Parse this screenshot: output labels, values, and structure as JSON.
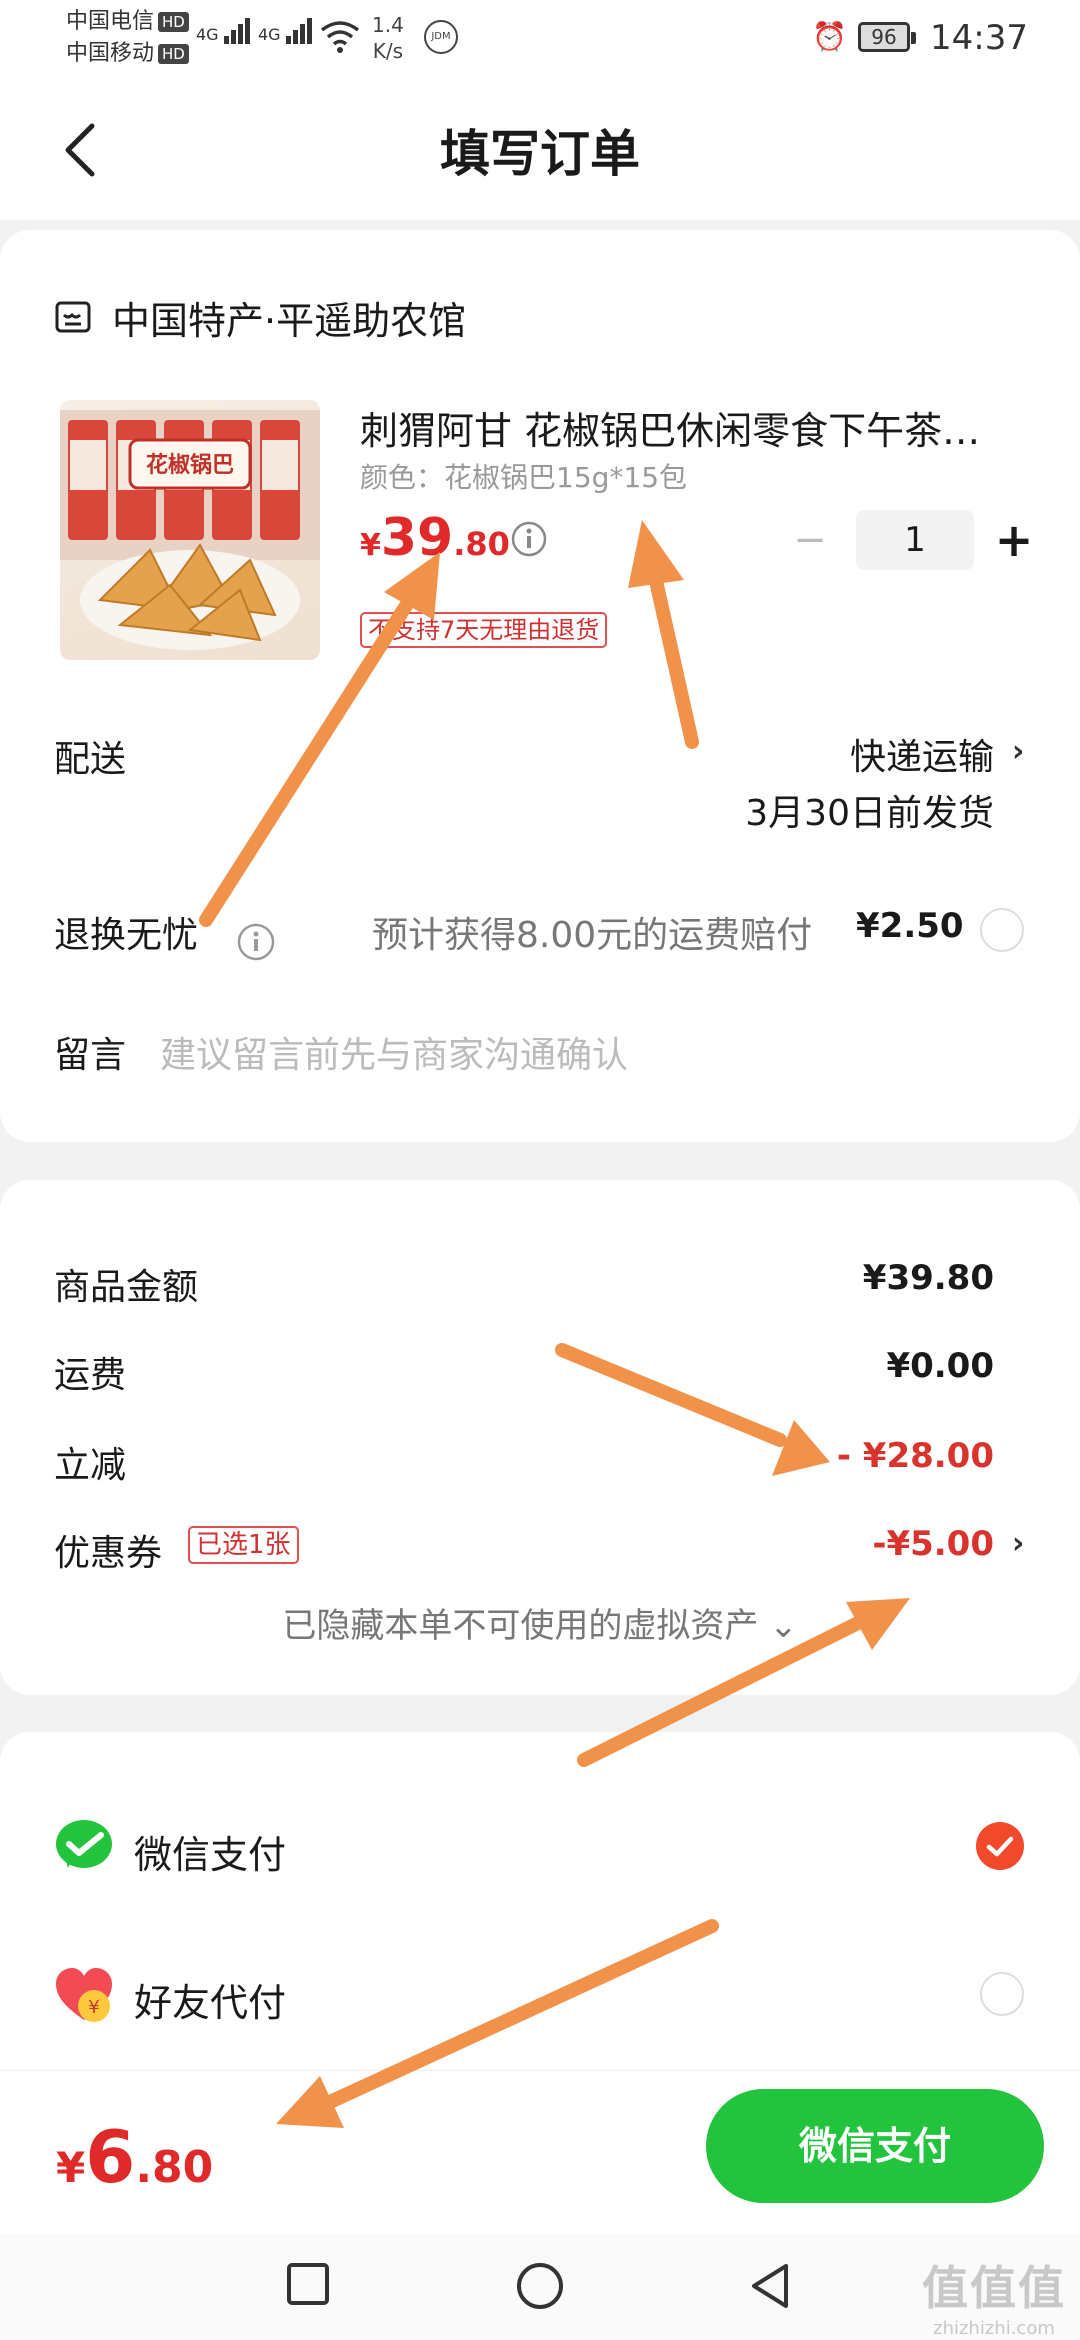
{
  "status_bar": {
    "carrier1": "中国电信",
    "carrier2": "中国移动",
    "hd": "HD",
    "net": "4G",
    "speed_value": "1.4",
    "speed_unit": "K/s",
    "jdm": "JDM",
    "battery": "96",
    "time": "14:37"
  },
  "header": {
    "title": "填写订单"
  },
  "shop": {
    "name": "中国特产·平遥助农馆"
  },
  "product": {
    "title": "刺猬阿甘 花椒锅巴休闲零食下午茶…",
    "spec": "颜色：花椒锅巴15g*15包",
    "price_currency": "¥",
    "price_int": "39",
    "price_dec": ".80",
    "quantity": "1",
    "minus": "−",
    "plus": "+",
    "tag": "不支持7天无理由退货",
    "pack_label": "花椒锅巴"
  },
  "delivery": {
    "label": "配送",
    "method": "快递运输",
    "ship_date": "3月30日前发货"
  },
  "return_ins": {
    "label": "退换无忧",
    "desc": "预计获得8.00元的运费赔付",
    "price": "¥2.50"
  },
  "message": {
    "label": "留言",
    "placeholder": "建议留言前先与商家沟通确认"
  },
  "summary": {
    "goods_label": "商品金额",
    "goods_value": "¥39.80",
    "shipping_label": "运费",
    "shipping_value": "¥0.00",
    "discount_label": "立减",
    "discount_value": "- ¥28.00",
    "coupon_label": "优惠券",
    "coupon_tag": "已选1张",
    "coupon_value": "-¥5.00",
    "hidden_note": "已隐藏本单不可使用的虚拟资产 ⌄"
  },
  "payment": {
    "wechat_label": "微信支付",
    "friend_label": "好友代付",
    "selected": "wechat"
  },
  "bottom": {
    "total_currency": "¥",
    "total_int": "6",
    "total_dec": ".80",
    "pay_button": "微信支付"
  },
  "watermark": {
    "line1": "值值值",
    "line2": "zhizhizhi.com"
  },
  "colors": {
    "accent_red": "#e02a2a",
    "wechat_green": "#22c33d",
    "arrow_orange": "#f0924a"
  }
}
